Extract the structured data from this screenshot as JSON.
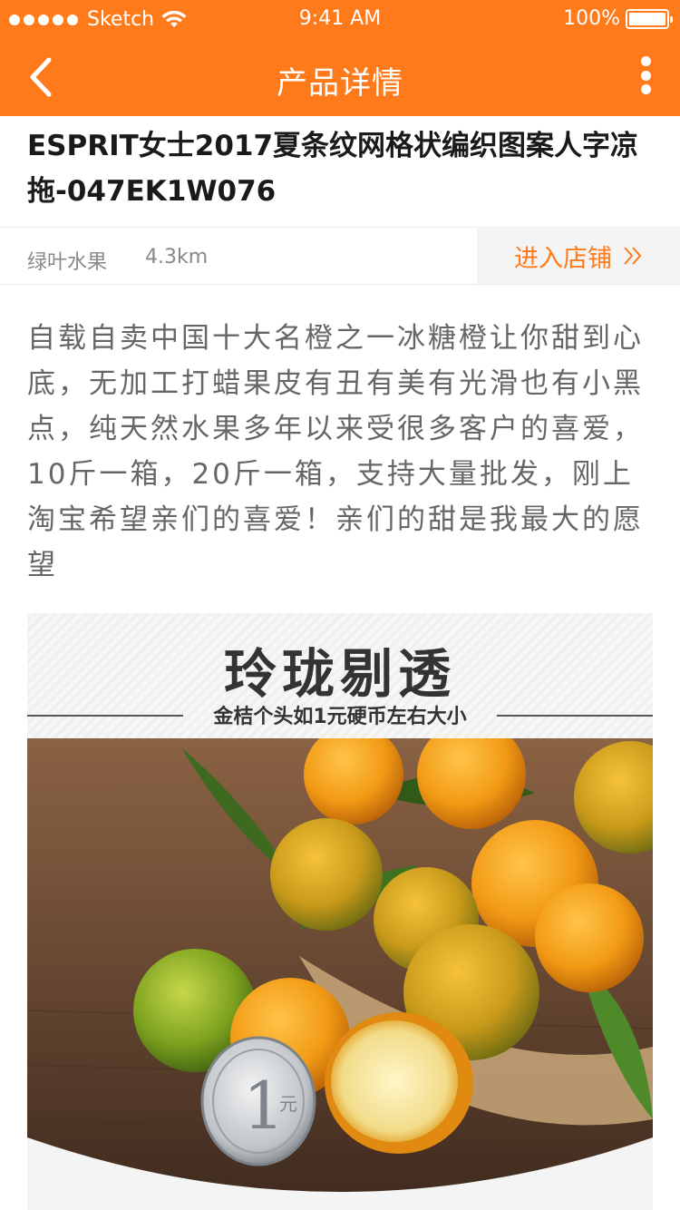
{
  "status_bar": {
    "carrier": "Sketch",
    "time": "9:41 AM",
    "battery": "100%"
  },
  "nav": {
    "title": "产品详情",
    "back_icon": "back-arrow-icon",
    "more_icon": "more-vertical-icon"
  },
  "product": {
    "title": "ESPRIT女士2017夏条纹网格状编织图案人字凉拖-047EK1W076"
  },
  "store": {
    "name": "绿叶水果",
    "distance": "4.3km",
    "enter_label": "进入店铺",
    "enter_icon": "double-chevron-right-icon"
  },
  "description": "自载自卖中国十大名橙之一冰糖橙让你甜到心底，无加工打蜡果皮有丑有美有光滑也有小黑点，纯天然水果多年以来受很多客户的喜爱，10斤一箱，20斤一箱，支持大量批发，刚上淘宝希望亲们的喜爱！亲们的甜是我最大的愿望",
  "promo": {
    "headline": "玲珑剔透",
    "subline": "金桔个头如1元硬币左右大小",
    "coin_text": "1",
    "coin_unit": "元"
  },
  "colors": {
    "accent": "#ff7a1a",
    "text_primary": "#1a1a1a",
    "text_secondary": "#888888",
    "description": "#666666"
  }
}
